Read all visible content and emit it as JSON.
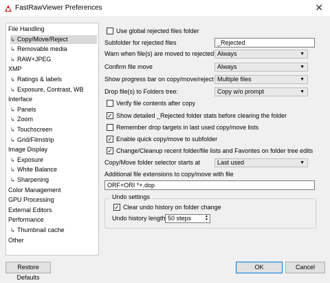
{
  "window": {
    "title": "FastRawViewer Preferences",
    "close_icon": "close-icon"
  },
  "sidebar": {
    "items": [
      {
        "label": "File Handling",
        "child": false
      },
      {
        "label": "Copy/Move/Reject",
        "child": true,
        "selected": true
      },
      {
        "label": "Removable media",
        "child": true
      },
      {
        "label": "RAW+JPEG",
        "child": true
      },
      {
        "label": "XMP",
        "child": false
      },
      {
        "label": "Ratings & labels",
        "child": true
      },
      {
        "label": "Exposure, Contrast, WB",
        "child": true
      },
      {
        "label": "Interface",
        "child": false
      },
      {
        "label": "Panels",
        "child": true
      },
      {
        "label": "Zoom",
        "child": true
      },
      {
        "label": "Touchscreen",
        "child": true
      },
      {
        "label": "Grid/Filmstrip",
        "child": true
      },
      {
        "label": "Image Display",
        "child": false
      },
      {
        "label": "Exposure",
        "child": true
      },
      {
        "label": "White Balance",
        "child": true
      },
      {
        "label": "Sharpening",
        "child": true
      },
      {
        "label": "Color Management",
        "child": false
      },
      {
        "label": "GPU Processing",
        "child": false
      },
      {
        "label": "External Editors",
        "child": false
      },
      {
        "label": "Performance",
        "child": false
      },
      {
        "label": "Thumbnail cache",
        "child": true
      },
      {
        "label": "Other",
        "child": false
      }
    ]
  },
  "settings": {
    "use_global_rejected": {
      "label": "Use global rejected files folder",
      "checked": false
    },
    "subfolder_label": "Subfolder for rejected files",
    "subfolder_value": "_Rejected",
    "warn_label": "Warn when file(s) are moved to rejected",
    "warn_value": "Always",
    "confirm_label": "Confirm file move",
    "confirm_value": "Always",
    "progress_label": "Show progress bar on copy/move/reject",
    "progress_value": "Multiple files",
    "drop_label": "Drop file(s) to Folders tree:",
    "drop_value": "Copy w/o prompt",
    "verify": {
      "label": "Verify file contents after copy",
      "checked": false
    },
    "detailed": {
      "label": "Show detailed _Rejected folder stats before clearing the folder",
      "checked": true
    },
    "remember": {
      "label": "Remember drop targets in last used copy/move lists",
      "checked": false
    },
    "quick": {
      "label": "Enable quick copy/move to subfolder",
      "checked": true
    },
    "change": {
      "label": "Change/Cleanup recent folder/file lists and Favorites on folder tree edits",
      "checked": true
    },
    "selector_label": "Copy/Move folder selector starts at",
    "selector_value": "Last used",
    "additional_label": "Additional file extensions to copy/move with file",
    "additional_value": "ORF+ORI *+.dop"
  },
  "undo": {
    "title": "Undo settings",
    "clear": {
      "label": "Clear undo history on folder change",
      "checked": true
    },
    "length_label": "Undo history length",
    "length_value": "50 steps"
  },
  "buttons": {
    "restore": "Restore Defaults",
    "ok": "OK",
    "cancel": "Cancel"
  }
}
